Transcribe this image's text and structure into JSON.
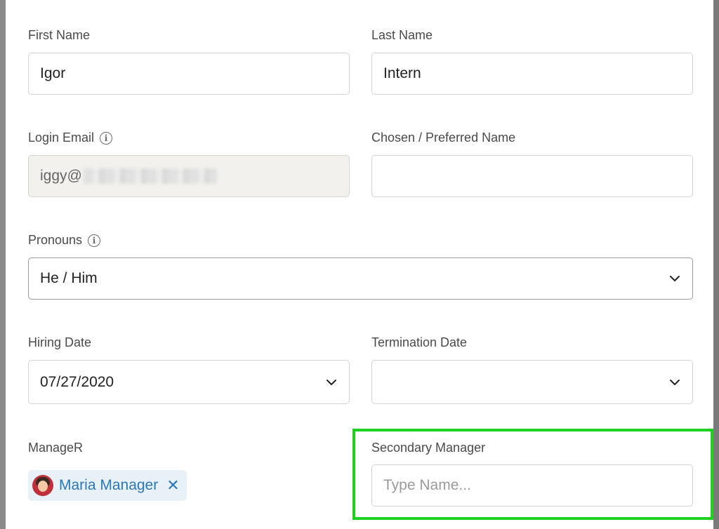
{
  "form": {
    "first_name": {
      "label": "First Name",
      "value": "Igor"
    },
    "last_name": {
      "label": "Last Name",
      "value": "Intern"
    },
    "login_email": {
      "label": "Login Email",
      "value": "iggy@"
    },
    "preferred_name": {
      "label": "Chosen / Preferred Name",
      "value": ""
    },
    "pronouns": {
      "label": "Pronouns",
      "value": "He / Him"
    },
    "hiring_date": {
      "label": "Hiring Date",
      "value": "07/27/2020"
    },
    "termination_date": {
      "label": "Termination Date",
      "value": ""
    },
    "manager": {
      "label": "ManageR",
      "chip_name": "Maria Manager"
    },
    "secondary_manager": {
      "label": "Secondary Manager",
      "placeholder": "Type Name..."
    }
  },
  "colors": {
    "highlight": "#1fd01f",
    "chip_bg": "#e8f1f8",
    "chip_text": "#2b78b8"
  },
  "icons": {
    "info": "info-icon",
    "chevron": "chevron-down-icon",
    "remove": "close-icon"
  }
}
